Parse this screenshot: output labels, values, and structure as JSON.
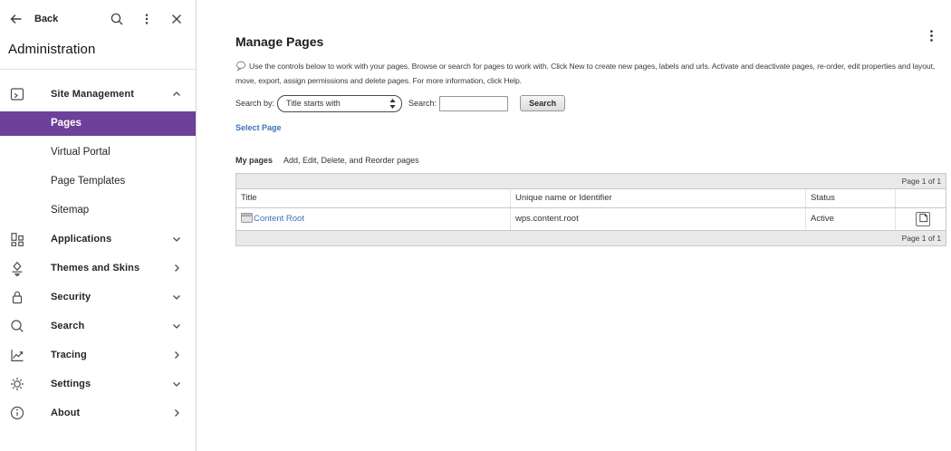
{
  "colors": {
    "accent_purple": "#6d4099",
    "link_blue": "#3a72b8",
    "table_bar_gray": "#e9e9e9",
    "border_gray": "#c9c9c9"
  },
  "sidebar": {
    "back_label": "Back",
    "top_icons": [
      "back-arrow-icon",
      "search-icon",
      "kebab-menu-icon",
      "close-icon"
    ],
    "title": "Administration",
    "items": [
      {
        "label": "Site Management",
        "icon": "site-management-icon",
        "state": "expanded",
        "selected": false
      },
      {
        "label": "Pages",
        "icon": null,
        "state": null,
        "selected": true
      },
      {
        "label": "Virtual Portal",
        "icon": null,
        "state": null,
        "selected": false
      },
      {
        "label": "Page Templates",
        "icon": null,
        "state": null,
        "selected": false
      },
      {
        "label": "Sitemap",
        "icon": null,
        "state": null,
        "selected": false
      },
      {
        "label": "Applications",
        "icon": "applications-icon",
        "state": "expanded",
        "selected": false
      },
      {
        "label": "Themes and Skins",
        "icon": "themes-icon",
        "state": "collapsed",
        "selected": false
      },
      {
        "label": "Security",
        "icon": "lock-icon",
        "state": "expanded",
        "selected": false
      },
      {
        "label": "Search",
        "icon": "search-icon",
        "state": "expanded",
        "selected": false
      },
      {
        "label": "Tracing",
        "icon": "tracing-chart-icon",
        "state": "collapsed",
        "selected": false
      },
      {
        "label": "Settings",
        "icon": "gear-icon",
        "state": "expanded",
        "selected": false
      },
      {
        "label": "About",
        "icon": "info-icon",
        "state": "collapsed",
        "selected": false
      }
    ]
  },
  "main": {
    "title": "Manage Pages",
    "kebab_icon": "kebab-menu-icon",
    "help_icon": "help-balloon-icon",
    "description": "Use the controls below to work with your pages. Browse or search for pages to work with. Click New to create new pages, labels and urls. Activate and deactivate pages, re-order, edit properties and layout, move, export, assign permissions and delete pages. For more information, click Help.",
    "search": {
      "by_label": "Search by:",
      "by_value": "Title starts with",
      "input_label": "Search:",
      "input_value": "",
      "button_label": "Search"
    },
    "select_page_link": "Select Page",
    "my_pages": {
      "label": "My pages",
      "hint": "Add, Edit, Delete, and Reorder pages"
    },
    "table": {
      "pager_top": "Page 1 of 1",
      "pager_bottom": "Page 1 of 1",
      "columns": [
        "Title",
        "Unique name or Identifier",
        "Status"
      ],
      "rows": [
        {
          "title": "Content Root",
          "title_icon": "page-icon",
          "unique_name": "wps.content.root",
          "status": "Active",
          "action_icon": "edit-page-layout-icon"
        }
      ]
    }
  }
}
